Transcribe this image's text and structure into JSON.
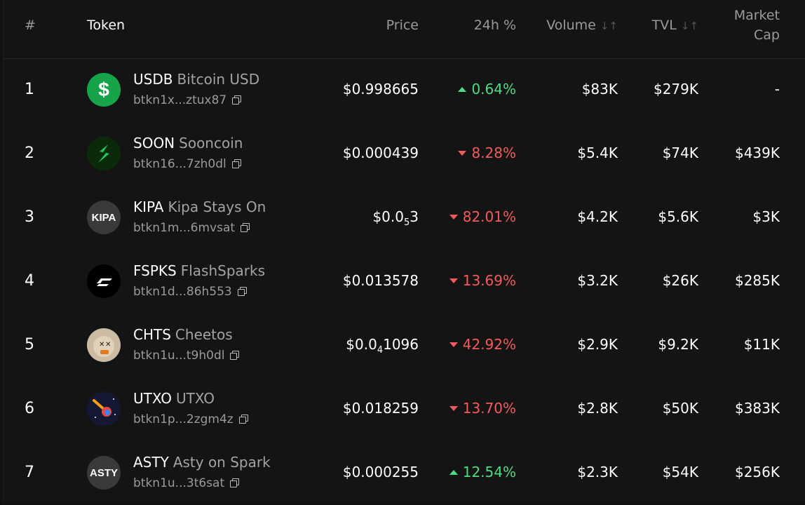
{
  "header": {
    "num": "#",
    "token": "Token",
    "price": "Price",
    "change": "24h %",
    "volume": "Volume",
    "tvl": "TVL",
    "mcap_line1": "Market",
    "mcap_line2": "Cap",
    "sort_glyph": "↓↑"
  },
  "rows": [
    {
      "num": "1",
      "symbol": "USDB",
      "name": "Bitcoin USD",
      "address": "btkn1x...ztux87",
      "price": "$0.998665",
      "price_sub": "",
      "price_tail": "",
      "change": "0.64%",
      "direction": "up",
      "volume": "$83K",
      "tvl": "$279K",
      "mcap": "-",
      "logo": "dollar-icon",
      "logo_color": "#16a34a"
    },
    {
      "num": "2",
      "symbol": "SOON",
      "name": "Sooncoin",
      "address": "btkn16...7zh0dl",
      "price": "$0.000439",
      "price_sub": "",
      "price_tail": "",
      "change": "8.28%",
      "direction": "down",
      "volume": "$5.4K",
      "tvl": "$74K",
      "mcap": "$439K",
      "logo": "lightning-s-icon",
      "logo_color": "#0c2e0c"
    },
    {
      "num": "3",
      "symbol": "KIPA",
      "name": "Kipa Stays On",
      "address": "btkn1m...6mvsat",
      "price": "$0.0",
      "price_sub": "5",
      "price_tail": "3",
      "change": "82.01%",
      "direction": "down",
      "volume": "$4.2K",
      "tvl": "$5.6K",
      "mcap": "$3K",
      "logo": "KIPA",
      "logo_color": "#3a3a3a"
    },
    {
      "num": "4",
      "symbol": "FSPKS",
      "name": "FlashSparks",
      "address": "btkn1d...86h553",
      "price": "$0.013578",
      "price_sub": "",
      "price_tail": "",
      "change": "13.69%",
      "direction": "down",
      "volume": "$3.2K",
      "tvl": "$26K",
      "mcap": "$285K",
      "logo": "flash-stripes-icon",
      "logo_color": "#000000"
    },
    {
      "num": "5",
      "symbol": "CHTS",
      "name": "Cheetos",
      "address": "btkn1u...t9h0dl",
      "price": "$0.0",
      "price_sub": "4",
      "price_tail": "1096",
      "change": "42.92%",
      "direction": "down",
      "volume": "$2.9K",
      "tvl": "$9.2K",
      "mcap": "$11K",
      "logo": "cheetos-face-icon",
      "logo_color": "#c8b8a0"
    },
    {
      "num": "6",
      "symbol": "UTXO",
      "name": "UTXO",
      "address": "btkn1p...2zgm4z",
      "price": "$0.018259",
      "price_sub": "",
      "price_tail": "",
      "change": "13.70%",
      "direction": "down",
      "volume": "$2.8K",
      "tvl": "$50K",
      "mcap": "$383K",
      "logo": "meteor-icon",
      "logo_color": "#151a3a"
    },
    {
      "num": "7",
      "symbol": "ASTY",
      "name": "Asty on Spark",
      "address": "btkn1u...3t6sat",
      "price": "$0.000255",
      "price_sub": "",
      "price_tail": "",
      "change": "12.54%",
      "direction": "up",
      "volume": "$2.3K",
      "tvl": "$54K",
      "mcap": "$256K",
      "logo": "ASTY",
      "logo_color": "#3a3a3a"
    }
  ]
}
